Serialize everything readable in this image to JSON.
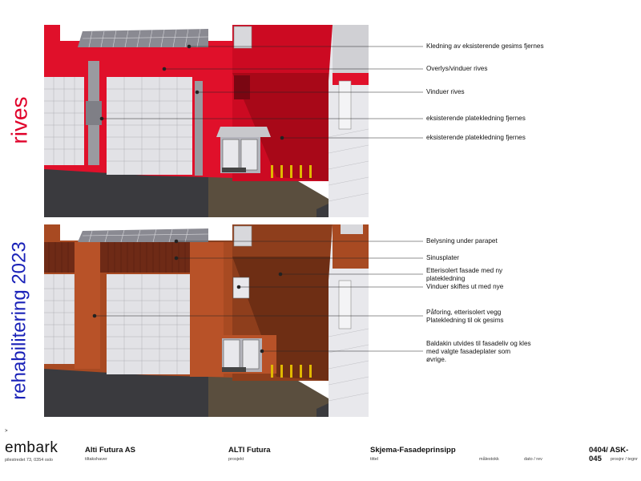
{
  "labels": {
    "top": "rives",
    "bottom": "rehabilitering 2023"
  },
  "callouts_top": [
    "Kledning av eksisterende gesims fjernes",
    "Overlys/vinduer rives",
    "Vinduer rives",
    "eksisterende platekledning fjernes",
    "eksisterende platekledning fjernes"
  ],
  "callouts_bottom": [
    "Belysning under parapet",
    "Sinusplater",
    "Etterisolert fasade med ny\nplatekledning",
    "Vinduer skiftes ut med nye",
    "Påforing, etterisolert vegg\nPlatekledning til ok gesims",
    "Baldakin utvides til fasadeliv og kles\nmed valgte fasadeplater som\nøvrige."
  ],
  "footer": {
    "marker": ">",
    "logo": "embark",
    "address": "pilestredet 73, 0354 oslo",
    "client": "Alti Futura AS",
    "client_caption": "tiltakshaver",
    "project": "ALTI Futura",
    "project_caption": "prosjekt",
    "title": "Skjema-Fasadeprinsipp",
    "title_caption": "tittel",
    "scale_caption": "målestokk",
    "date_caption": "dato / rev",
    "drawing_no": "0404/ ASK-045",
    "drawing_no_caption": "prosjnr / tegnr"
  },
  "colors": {
    "demolish_red": "#e0102a",
    "rehab_brown": "#a84a22",
    "label_red": "#e0002a",
    "label_blue": "#1a22b8"
  }
}
